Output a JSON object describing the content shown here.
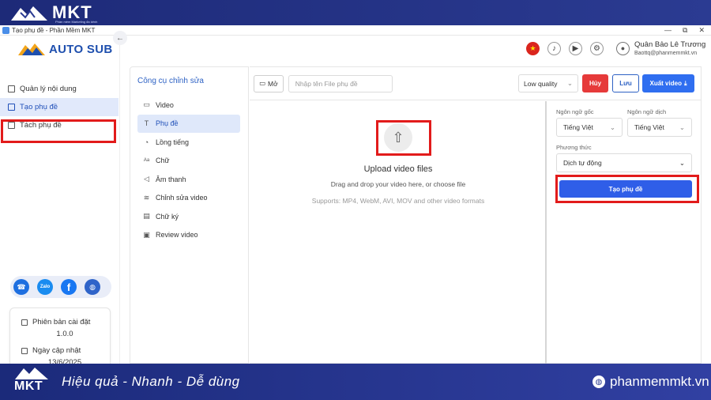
{
  "banner": {
    "brand": "MKT",
    "tagline": "Phần mềm Marketing đa kênh"
  },
  "window": {
    "title": "Tạo phụ đề - Phần Mềm MKT",
    "controls": [
      "—",
      "⧉",
      "✕"
    ]
  },
  "sidebar": {
    "brand": "AUTO SUB",
    "collapse_icon": "←",
    "items": [
      {
        "label": "Quản lý nội dung",
        "icon": "content-icon"
      },
      {
        "label": "Tạo phụ đề",
        "icon": "subtitle-icon"
      },
      {
        "label": "Tách phụ đề",
        "icon": "split-icon"
      }
    ],
    "social": [
      {
        "icon": "support-icon",
        "text": "☎"
      },
      {
        "icon": "zalo-icon",
        "text": "Zalo"
      },
      {
        "icon": "facebook-icon",
        "text": "f"
      },
      {
        "icon": "globe-icon",
        "text": "◍"
      }
    ],
    "version_label": "Phiên bản cài đặt",
    "version_value": "1.0.0",
    "update_label": "Ngày cập nhật",
    "update_value": "13/6/2025"
  },
  "header": {
    "flag": "★",
    "user_name": "Quân Bảo Lê Trương",
    "user_email": "Baottq@phanmemmkt.vn"
  },
  "tools": {
    "title": "Công cụ chỉnh sửa",
    "items": [
      {
        "label": "Video",
        "icon": "▭"
      },
      {
        "label": "Phụ đề",
        "icon": "T"
      },
      {
        "label": "Lồng tiếng",
        "icon": "◔"
      },
      {
        "label": "Chữ",
        "icon": "Aa"
      },
      {
        "label": "Âm thanh",
        "icon": "◁"
      },
      {
        "label": "Chỉnh sửa video",
        "icon": "≋"
      },
      {
        "label": "Chữ ký",
        "icon": "▤"
      },
      {
        "label": "Review video",
        "icon": "▣"
      }
    ]
  },
  "toolbar": {
    "open_label": "Mở",
    "name_placeholder": "Nhập tên File phụ đề",
    "quality": "Low quality",
    "cancel": "Hủy",
    "save": "Lưu",
    "export": "Xuất video"
  },
  "upload": {
    "title": "Upload video files",
    "subtitle": "Drag and drop your video here, or choose file",
    "formats": "Supports: MP4, WebM, AVI, MOV and other video formats"
  },
  "settings": {
    "source_lang_label": "Ngôn ngữ gốc",
    "source_lang": "Tiếng Việt",
    "target_lang_label": "Ngôn ngữ dịch",
    "target_lang": "Tiếng Việt",
    "method_label": "Phương thức",
    "method": "Dịch tự động",
    "create_button": "Tạo phụ đề"
  },
  "footer": {
    "brand": "MKT",
    "slogan": "Hiệu quả - Nhanh  - Dễ dùng",
    "website": "phanmemmkt.vn"
  }
}
